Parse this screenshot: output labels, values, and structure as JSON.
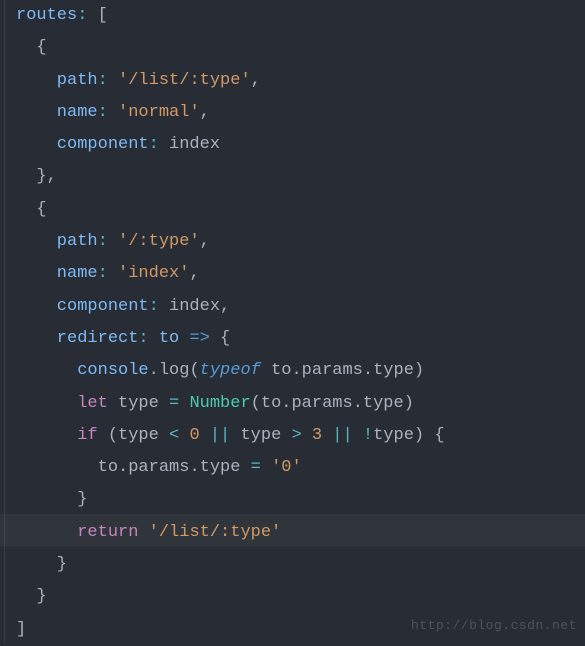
{
  "watermark": "http://blog.csdn.net",
  "code": {
    "l0_a": "routes",
    "l0_b": ":",
    "l0_c": " [",
    "l1": "  {",
    "l2_a": "    path",
    "l2_b": ":",
    "l2_c": " ",
    "l2_d": "'/list/:type'",
    "l2_e": ",",
    "l3_a": "    name",
    "l3_b": ":",
    "l3_c": " ",
    "l3_d": "'normal'",
    "l3_e": ",",
    "l4_a": "    component",
    "l4_b": ":",
    "l4_c": " ",
    "l4_d": "index",
    "l5": "  },",
    "l6": "  {",
    "l7_a": "    path",
    "l7_b": ":",
    "l7_c": " ",
    "l7_d": "'/:type'",
    "l7_e": ",",
    "l8_a": "    name",
    "l8_b": ":",
    "l8_c": " ",
    "l8_d": "'index'",
    "l8_e": ",",
    "l9_a": "    component",
    "l9_b": ":",
    "l9_c": " ",
    "l9_d": "index",
    "l9_e": ",",
    "l10_a": "    redirect",
    "l10_b": ":",
    "l10_c": " ",
    "l10_d": "to",
    "l10_e": " ",
    "l10_f": "=>",
    "l10_g": " {",
    "l11_a": "      console",
    "l11_b": ".",
    "l11_c": "log",
    "l11_d": "(",
    "l11_e": "typeof",
    "l11_f": " to",
    "l11_g": ".",
    "l11_h": "params",
    "l11_i": ".",
    "l11_j": "type",
    "l11_k": ")",
    "l12_a": "      ",
    "l12_b": "let",
    "l12_c": " type ",
    "l12_d": "=",
    "l12_e": " ",
    "l12_f": "Number",
    "l12_g": "(to",
    "l12_h": ".",
    "l12_i": "params",
    "l12_j": ".",
    "l12_k": "type",
    "l12_l": ")",
    "l13_a": "      ",
    "l13_b": "if",
    "l13_c": " (type ",
    "l13_d": "<",
    "l13_e": " ",
    "l13_f": "0",
    "l13_g": " ",
    "l13_h": "||",
    "l13_i": " type ",
    "l13_j": ">",
    "l13_k": " ",
    "l13_l": "3",
    "l13_m": " ",
    "l13_n": "||",
    "l13_o": " ",
    "l13_p": "!",
    "l13_q": "type) {",
    "l14_a": "        to",
    "l14_b": ".",
    "l14_c": "params",
    "l14_d": ".",
    "l14_e": "type ",
    "l14_f": "=",
    "l14_g": " ",
    "l14_h": "'0'",
    "l15": "      }",
    "l16_a": "      ",
    "l16_b": "return",
    "l16_c": " ",
    "l16_d": "'/list/:type'",
    "l17": "    }",
    "l18": "  }",
    "l19": "]"
  }
}
